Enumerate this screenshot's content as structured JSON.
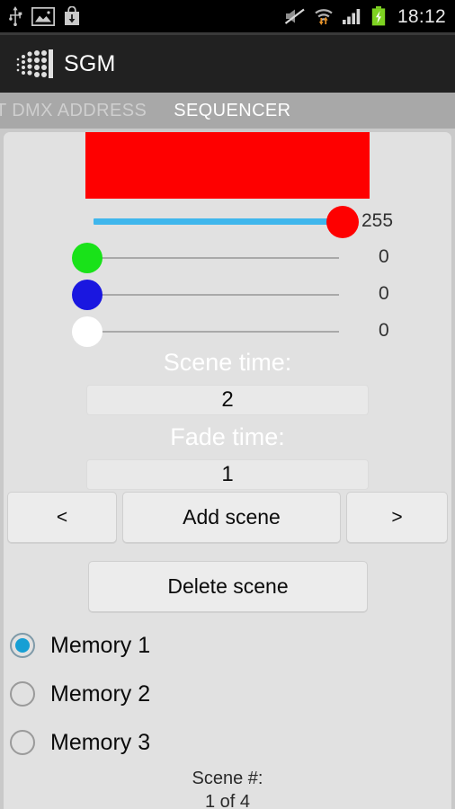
{
  "statusbar": {
    "time": "18:12",
    "left_icons": [
      "usb-icon",
      "screenshot-image-icon",
      "app-download-icon"
    ],
    "right_icons": [
      "mute-icon",
      "wifi-transfer-icon",
      "cellular-signal-icon",
      "battery-charging-icon"
    ]
  },
  "actionbar": {
    "title": "SGM",
    "logo": "sgm-dotmatrix-logo"
  },
  "tabs": [
    {
      "label": "T DMX ADDRESS",
      "active": false
    },
    {
      "label": "SEQUENCER",
      "active": true
    }
  ],
  "colors": {
    "preview": "#fe0000",
    "red_thumb": "#fe0000",
    "green_thumb": "#19e219",
    "blue_thumb": "#1a17e0",
    "white_thumb": "#ffffff",
    "track_fill": "#3fb6ec",
    "track_empty": "#a9a9a9",
    "radio_accent": "#169fd4",
    "card_bg": "#e1e1e1",
    "actionbar_bg": "#212121",
    "tabbar_bg": "#a8a8a8"
  },
  "sliders": [
    {
      "name": "red",
      "value": "255",
      "percent": 100,
      "thumb_color": "#fe0000"
    },
    {
      "name": "green",
      "value": "0",
      "percent": 0,
      "thumb_color": "#19e219"
    },
    {
      "name": "blue",
      "value": "0",
      "percent": 0,
      "thumb_color": "#1a17e0"
    },
    {
      "name": "white",
      "value": "0",
      "percent": 0,
      "thumb_color": "#ffffff"
    }
  ],
  "scene_time": {
    "label": "Scene time:",
    "value": "2"
  },
  "fade_time": {
    "label": "Fade time:",
    "value": "1"
  },
  "buttons": {
    "prev": "<",
    "add": "Add scene",
    "next": ">",
    "delete": "Delete scene"
  },
  "memories": [
    {
      "label": "Memory 1",
      "selected": true
    },
    {
      "label": "Memory 2",
      "selected": false
    },
    {
      "label": "Memory 3",
      "selected": false
    }
  ],
  "footer": {
    "title": "Scene #:",
    "position": "1 of 4"
  }
}
